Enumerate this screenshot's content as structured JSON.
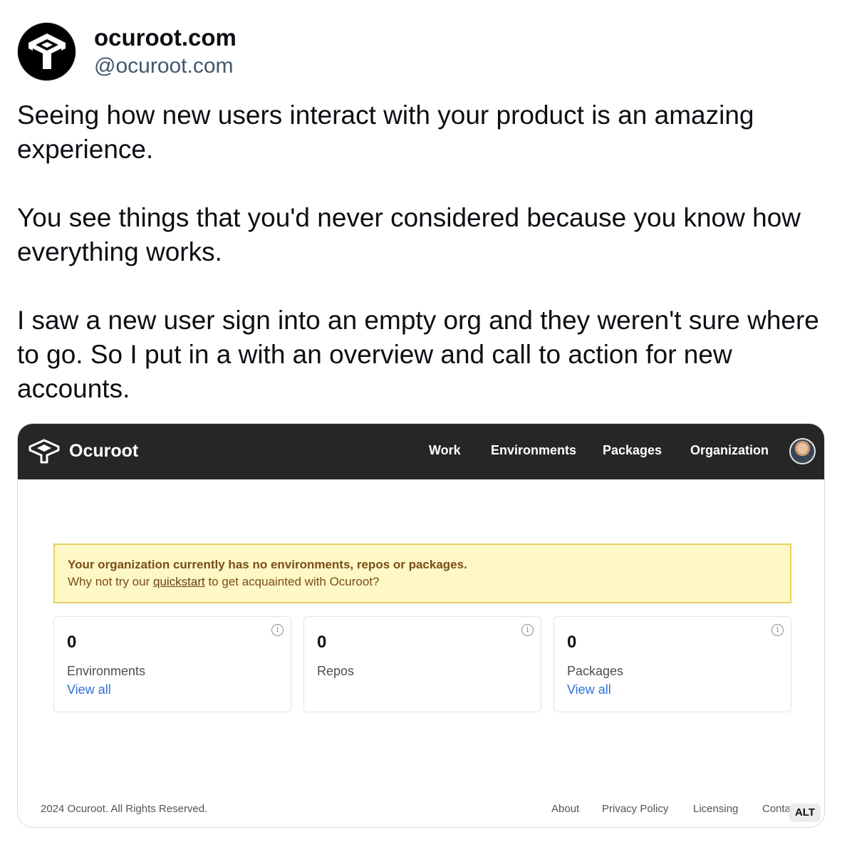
{
  "post": {
    "display_name": "ocuroot.com",
    "handle": "@ocuroot.com",
    "text": "Seeing how new users interact with your product is an amazing experience.\n\nYou see things that you'd never considered because you know how everything works.\n\nI saw a new user sign into an empty org and they weren't sure where to go. So I put in a with an overview and call to action for new accounts.",
    "alt_badge": "ALT"
  },
  "app": {
    "brand": "Ocuroot",
    "nav": [
      "Work",
      "Environments",
      "Packages",
      "Organization"
    ],
    "alert": {
      "title": "Your organization currently has no environments, repos or packages.",
      "sub_prefix": "Why not try our ",
      "sub_link": "quickstart",
      "sub_suffix": " to get acquainted with Ocuroot?"
    },
    "cards": [
      {
        "count": "0",
        "label": "Environments",
        "link": "View all"
      },
      {
        "count": "0",
        "label": "Repos",
        "link": ""
      },
      {
        "count": "0",
        "label": "Packages",
        "link": "View all"
      }
    ],
    "footer": {
      "copyright": "2024 Ocuroot. All Rights Reserved.",
      "links": [
        "About",
        "Privacy Policy",
        "Licensing",
        "Conta"
      ]
    }
  },
  "colors": {
    "navbar": "#262626",
    "alert_bg": "#fdf8c6",
    "alert_border": "#e7cf63",
    "link_blue": "#2e6fdb"
  },
  "icons": [
    "ocuroot-logo-icon",
    "info-icon",
    "user-avatar"
  ]
}
